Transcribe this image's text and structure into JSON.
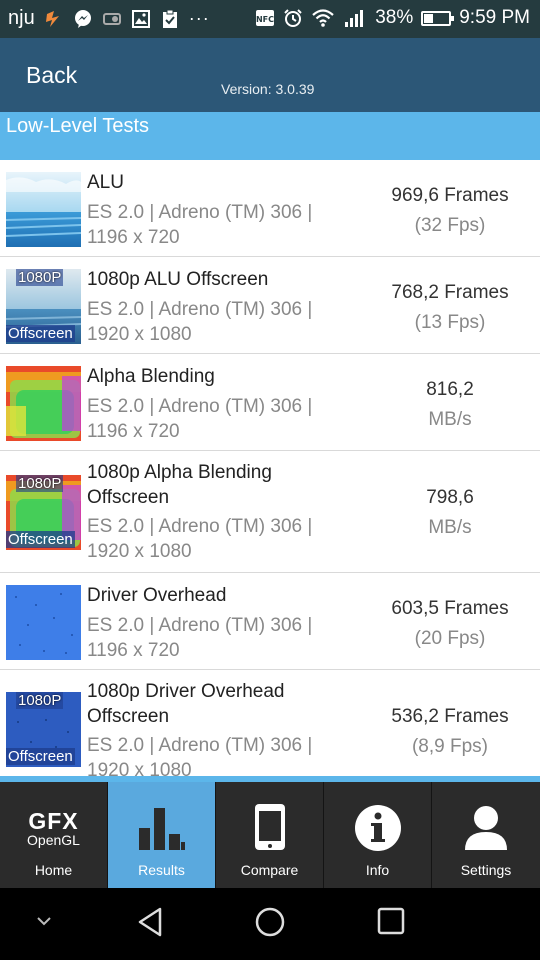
{
  "status_bar": {
    "carrier": "nju",
    "battery_percent": "38%",
    "battery_level": 0.38,
    "time": "9:59 PM",
    "overflow": "···",
    "icons": [
      "sound-icon",
      "messenger-icon",
      "switch-icon",
      "image-icon",
      "clipboard-icon",
      "nfc-icon",
      "alarm-icon",
      "wifi-icon",
      "signal-icon",
      "battery-icon"
    ]
  },
  "header": {
    "back_label": "Back",
    "version": "Version: 3.0.39"
  },
  "section": {
    "title": "Low-Level Tests"
  },
  "tests": [
    {
      "name": "ALU",
      "detail": "ES 2.0 | Adreno (TM) 306 | 1196 x 720",
      "score": "969,6 Frames",
      "score_sub": "(32 Fps)",
      "thumb": "sky-water",
      "badge_top": "",
      "badge_bottom": ""
    },
    {
      "name": "1080p ALU Offscreen",
      "detail": "ES 2.0 | Adreno (TM) 306 | 1920 x 1080",
      "score": "768,2 Frames",
      "score_sub": "(13 Fps)",
      "thumb": "sky-water",
      "badge_top": "1080P",
      "badge_bottom": "Offscreen"
    },
    {
      "name": "Alpha Blending",
      "detail": "ES 2.0 | Adreno (TM) 306 | 1196 x 720",
      "score": "816,2",
      "score_sub": "MB/s",
      "thumb": "blend",
      "badge_top": "",
      "badge_bottom": ""
    },
    {
      "name": "1080p Alpha Blending Offscreen",
      "detail": "ES 2.0 | Adreno (TM) 306 | 1920 x 1080",
      "score": "798,6",
      "score_sub": "MB/s",
      "thumb": "blend",
      "badge_top": "1080P",
      "badge_bottom": "Offscreen"
    },
    {
      "name": "Driver Overhead",
      "detail": "ES 2.0 | Adreno (TM) 306 | 1196 x 720",
      "score": "603,5 Frames",
      "score_sub": "(20 Fps)",
      "thumb": "blue",
      "badge_top": "",
      "badge_bottom": ""
    },
    {
      "name": "1080p Driver Overhead Offscreen",
      "detail": "ES 2.0 | Adreno (TM) 306 | 1920 x 1080",
      "score": "536,2 Frames",
      "score_sub": "(8,9 Fps)",
      "thumb": "blue-dark",
      "badge_top": "1080P",
      "badge_bottom": "Offscreen"
    }
  ],
  "tabs": [
    {
      "label": "Home",
      "icon": "gfx-logo-icon",
      "logo_main": "GFX",
      "logo_sub": "OpenGL"
    },
    {
      "label": "Results",
      "icon": "bar-chart-icon"
    },
    {
      "label": "Compare",
      "icon": "phone-icon"
    },
    {
      "label": "Info",
      "icon": "info-icon"
    },
    {
      "label": "Settings",
      "icon": "user-icon"
    }
  ],
  "active_tab": "Results",
  "colors": {
    "status_bar": "#253b3f",
    "header": "#2c5777",
    "section": "#5cb6ea",
    "active_tab": "#5aa9de",
    "tab_bar": "#2b2b2b"
  },
  "nav_buttons": [
    "collapse-icon",
    "back-triangle-icon",
    "home-circle-icon",
    "recents-square-icon"
  ]
}
